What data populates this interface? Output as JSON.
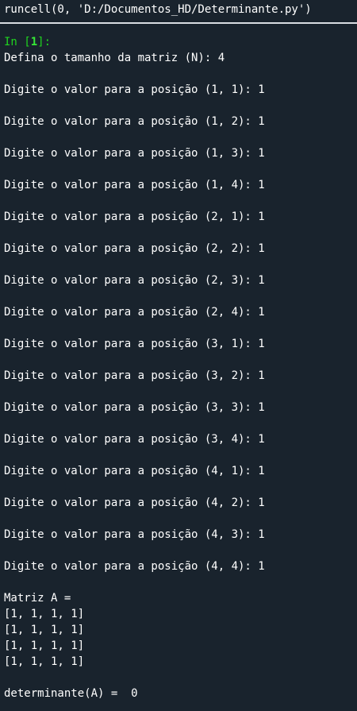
{
  "console": {
    "run_command": "runcell(0, 'D:/Documentos_HD/Determinante.py')",
    "prompt": {
      "label": "In [",
      "number": "1",
      "close": "]:"
    },
    "size_prompt": "Defina o tamanho da matriz (N): 4",
    "inputs": [
      "Digite o valor para a posição (1, 1): 1",
      "Digite o valor para a posição (1, 2): 1",
      "Digite o valor para a posição (1, 3): 1",
      "Digite o valor para a posição (1, 4): 1",
      "Digite o valor para a posição (2, 1): 1",
      "Digite o valor para a posição (2, 2): 1",
      "Digite o valor para a posição (2, 3): 1",
      "Digite o valor para a posição (2, 4): 1",
      "Digite o valor para a posição (3, 1): 1",
      "Digite o valor para a posição (3, 2): 1",
      "Digite o valor para a posição (3, 3): 1",
      "Digite o valor para a posição (3, 4): 1",
      "Digite o valor para a posição (4, 1): 1",
      "Digite o valor para a posição (4, 2): 1",
      "Digite o valor para a posição (4, 3): 1",
      "Digite o valor para a posição (4, 4): 1"
    ],
    "matrix_title": "Matriz A =",
    "matrix_rows": [
      "[1, 1, 1, 1]",
      "[1, 1, 1, 1]",
      "[1, 1, 1, 1]",
      "[1, 1, 1, 1]"
    ],
    "result": "determinante(A) =  0"
  },
  "colors": {
    "background": "#19232d",
    "text": "#ffffff",
    "prompt": "#1fd51f"
  }
}
